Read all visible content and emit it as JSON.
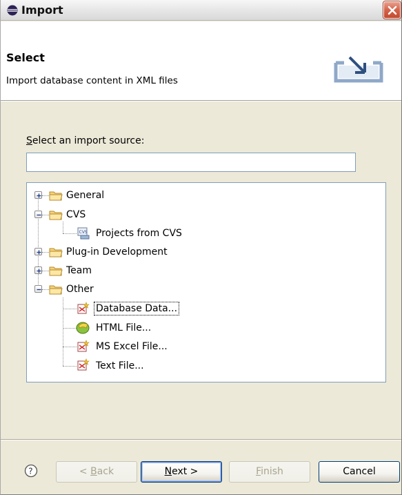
{
  "window": {
    "title": "Import"
  },
  "header": {
    "page_title": "Select",
    "description": "Import database content in XML files"
  },
  "source": {
    "label_mnemonic": "S",
    "label_rest": "elect an import source:",
    "filter_value": ""
  },
  "tree": {
    "items": [
      {
        "label": "General",
        "expanded": false,
        "icon": "folder-icon"
      },
      {
        "label": "CVS",
        "expanded": true,
        "icon": "folder-open-icon"
      },
      {
        "label": "Projects from CVS",
        "icon": "cvs-project-icon"
      },
      {
        "label": "Plug-in Development",
        "expanded": false,
        "icon": "folder-icon"
      },
      {
        "label": "Team",
        "expanded": false,
        "icon": "folder-icon"
      },
      {
        "label": "Other",
        "expanded": true,
        "icon": "folder-open-icon"
      },
      {
        "label": "Database Data...",
        "icon": "xml-file-icon",
        "selected": true
      },
      {
        "label": "HTML File...",
        "icon": "html-file-icon"
      },
      {
        "label": "MS Excel File...",
        "icon": "xml-file-icon"
      },
      {
        "label": "Text File...",
        "icon": "xml-file-icon"
      }
    ]
  },
  "buttons": {
    "back_mnemonic": "B",
    "back_rest": "ack",
    "back_prefix": "< ",
    "next_mnemonic": "N",
    "next_rest": "ext >",
    "finish_mnemonic": "F",
    "finish_rest": "inish",
    "cancel": "Cancel"
  },
  "colors": {
    "dialog_bg": "#ece9d8",
    "input_border": "#7f9db9",
    "close_button": "#d4634a"
  }
}
